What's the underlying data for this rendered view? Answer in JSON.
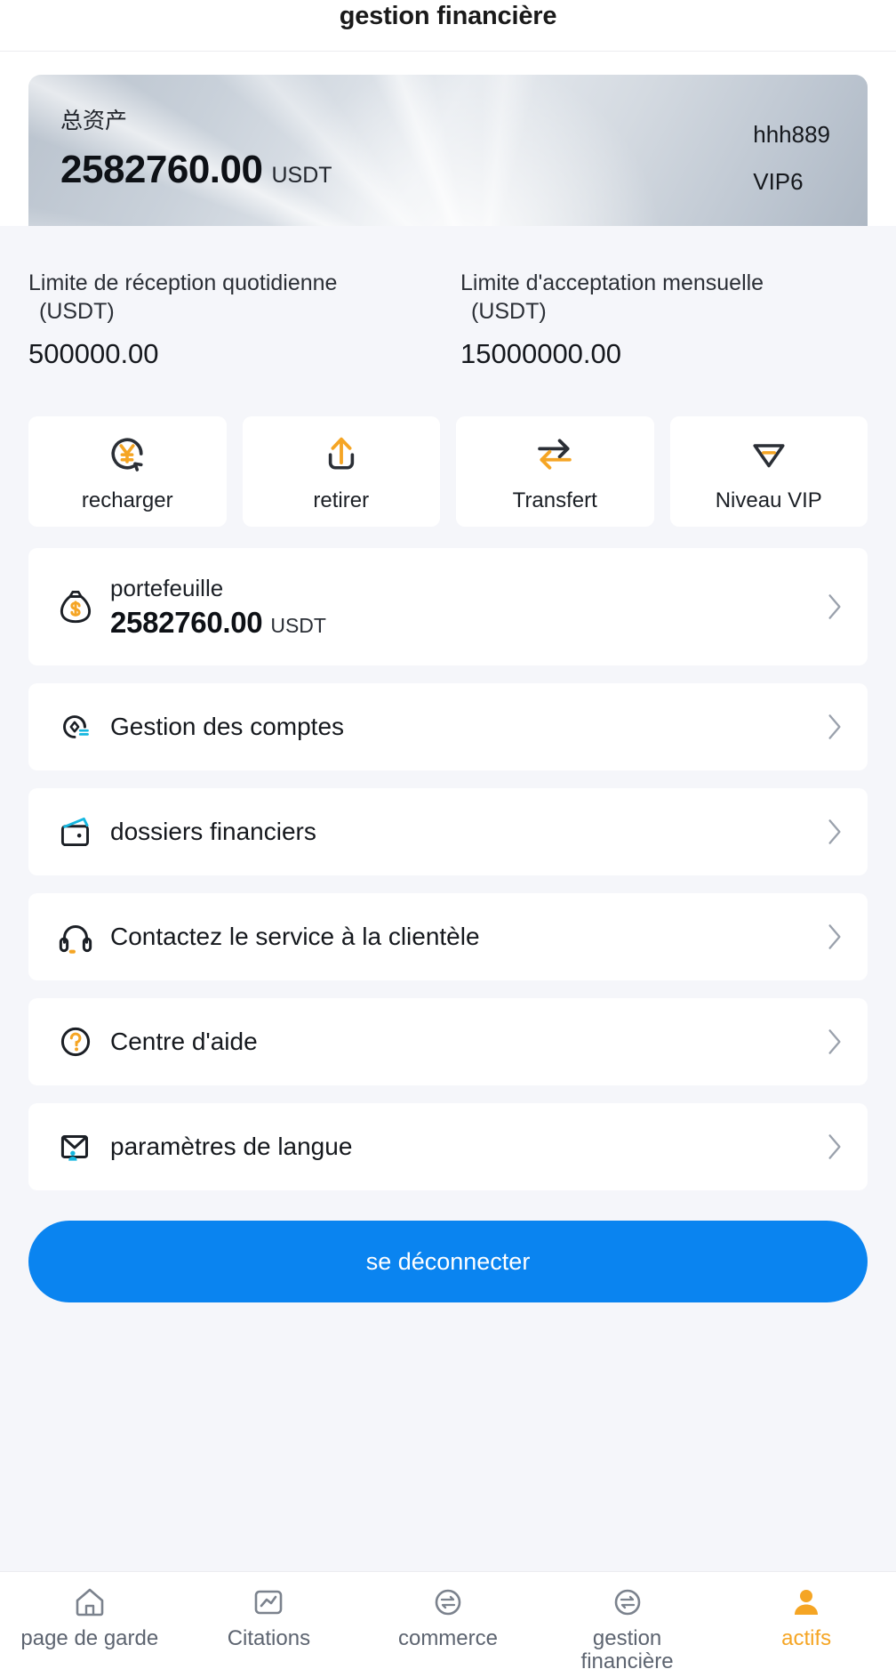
{
  "header": {
    "title": "gestion financière"
  },
  "hero": {
    "total_label": "总资产",
    "total_amount": "2582760.00",
    "currency": "USDT",
    "username": "hhh889",
    "vip_level": "VIP6"
  },
  "limits": [
    {
      "title": "Limite de réception quotidienne",
      "unit": "(USDT)",
      "value": "500000.00"
    },
    {
      "title": "Limite d'acceptation mensuelle",
      "unit": "(USDT)",
      "value": "15000000.00"
    }
  ],
  "actions": [
    {
      "label": "recharger",
      "icon": "recharge-yen-icon"
    },
    {
      "label": "retirer",
      "icon": "withdraw-upload-icon"
    },
    {
      "label": "Transfert",
      "icon": "transfer-arrows-icon"
    },
    {
      "label": "Niveau VIP",
      "icon": "vip-diamond-icon"
    }
  ],
  "wallet": {
    "title": "portefeuille",
    "amount": "2582760.00",
    "currency": "USDT",
    "icon": "money-bag-icon"
  },
  "menu": [
    {
      "label": "Gestion des comptes",
      "icon": "account-management-icon"
    },
    {
      "label": "dossiers financiers",
      "icon": "wallet-records-icon"
    },
    {
      "label": "Contactez le service à la clientèle",
      "icon": "headset-support-icon"
    },
    {
      "label": "Centre d'aide",
      "icon": "question-help-icon"
    },
    {
      "label": "paramètres de langue",
      "icon": "envelope-language-icon"
    }
  ],
  "logout": {
    "label": "se déconnecter"
  },
  "tabbar": [
    {
      "label": "page de garde",
      "icon": "home-icon",
      "active": false
    },
    {
      "label": "Citations",
      "icon": "chart-quotes-icon",
      "active": false
    },
    {
      "label": "commerce",
      "icon": "trade-swap-icon",
      "active": false
    },
    {
      "label": "gestion financière",
      "icon": "finance-swap-icon",
      "active": false
    },
    {
      "label": "actifs",
      "icon": "user-assets-icon",
      "active": true
    }
  ],
  "colors": {
    "accent_orange": "#f5a524",
    "accent_blue": "#0a84f0",
    "cyan": "#15b7e0",
    "bg": "#f5f6fa"
  }
}
